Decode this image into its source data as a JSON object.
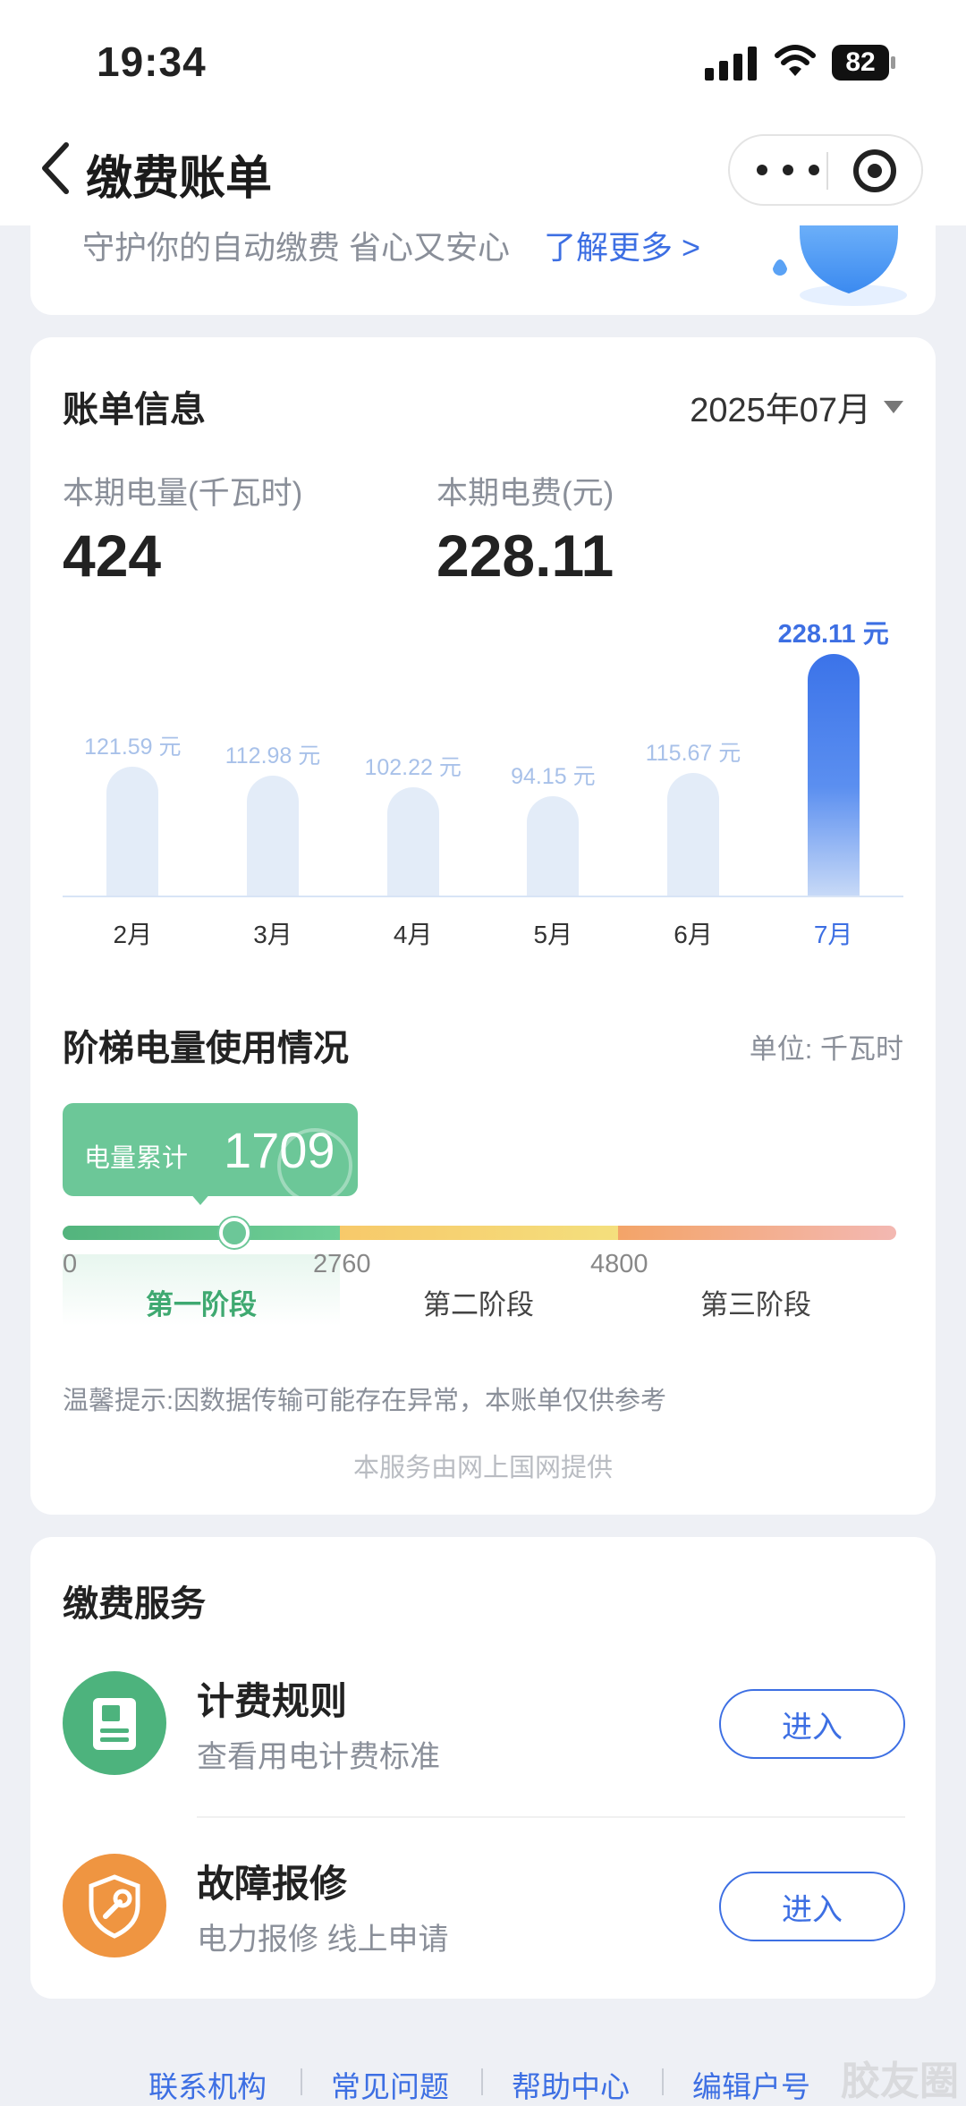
{
  "status_bar": {
    "time": "19:34",
    "battery": "82"
  },
  "nav": {
    "title": "缴费账单"
  },
  "banner": {
    "text": "守护你的自动缴费 省心又安心",
    "link": "了解更多 >"
  },
  "bill": {
    "title": "账单信息",
    "period": "2025年07月",
    "energy_label": "本期电量(千瓦时)",
    "energy_value": "424",
    "fee_label": "本期电费(元)",
    "fee_value": "228.11"
  },
  "chart_data": {
    "type": "bar",
    "categories": [
      "2月",
      "3月",
      "4月",
      "5月",
      "6月",
      "7月"
    ],
    "values": [
      121.59,
      112.98,
      102.22,
      94.15,
      115.67,
      228.11
    ],
    "value_labels": [
      "121.59 元",
      "112.98 元",
      "102.22 元",
      "94.15 元",
      "115.67 元",
      "228.11 元"
    ],
    "highlight_index": 5,
    "ylim": [
      0,
      228.11
    ],
    "colors": {
      "bar": "#e3ecf8",
      "active": "#3b73e9"
    }
  },
  "tier": {
    "title": "阶梯电量使用情况",
    "unit": "单位: 千瓦时",
    "usage_label": "电量累计",
    "usage_value": "1709",
    "usage_fraction_of_stage1": 0.619,
    "ticks": [
      "0",
      "2760",
      "4800"
    ],
    "stages": [
      "第一阶段",
      "第二阶段",
      "第三阶段"
    ],
    "notice": "温馨提示:因数据传输可能存在异常，本账单仅供参考",
    "provider": "本服务由网上国网提供"
  },
  "services": {
    "title": "缴费服务",
    "items": [
      {
        "name": "计费规则",
        "desc": "查看用电计费标准",
        "button": "进入",
        "icon": "document-icon"
      },
      {
        "name": "故障报修",
        "desc": "电力报修 线上申请",
        "button": "进入",
        "icon": "wrench-shield-icon"
      }
    ]
  },
  "footer": {
    "links": [
      "联系机构",
      "常见问题",
      "帮助中心",
      "编辑户号"
    ]
  },
  "watermark": "胶友圈"
}
